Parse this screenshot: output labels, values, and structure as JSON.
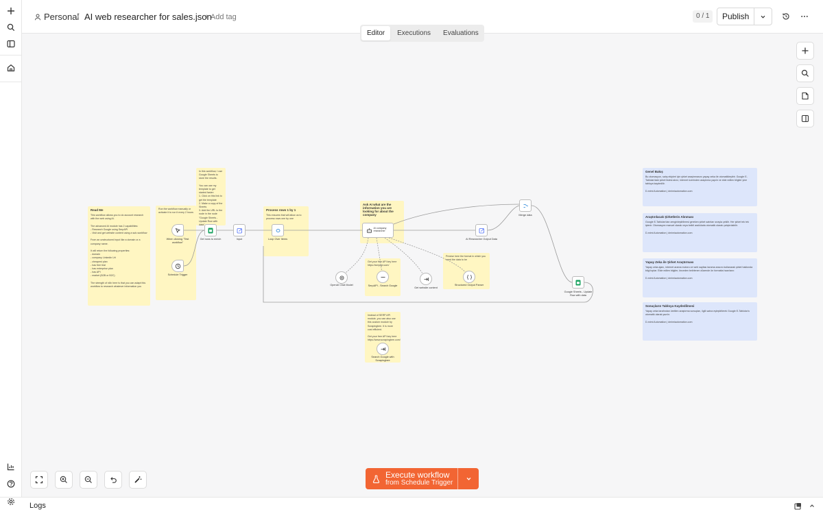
{
  "header": {
    "workspace": "Personal",
    "workflow_name": "AI web researcher for sales.json",
    "add_tag": "+ Add tag",
    "version_counter": "0 / 1",
    "publish_label": "Publish"
  },
  "tabs": [
    {
      "label": "Editor",
      "active": true
    },
    {
      "label": "Executions",
      "active": false
    },
    {
      "label": "Evaluations",
      "active": false
    }
  ],
  "execute": {
    "label": "Execute workflow",
    "sublabel": "from Schedule Trigger",
    "color": "#f26533"
  },
  "logs": {
    "label": "Logs"
  },
  "canvas": {
    "nodes": [
      {
        "label": "When clicking \"Test workflow\"",
        "icon": "cursor-icon"
      },
      {
        "label": "Schedule Trigger",
        "icon": "clock-icon"
      },
      {
        "label": "Get rows to enrich",
        "icon": "sheets-icon"
      },
      {
        "label": "Input",
        "icon": "edit-icon"
      },
      {
        "label": "Loop Over Items",
        "icon": "loop-icon"
      },
      {
        "label": "AI company researcher",
        "icon": "robot-icon"
      },
      {
        "label": "AI Researcher Output Data",
        "icon": "edit-icon"
      },
      {
        "label": "Merge data",
        "icon": "merge-icon"
      },
      {
        "label": "Google Sheets - Update Row with data",
        "icon": "sheets-icon"
      },
      {
        "label": "OpenAI Chat Model",
        "icon": "openai-icon"
      },
      {
        "label": "SerpAPI - Search Google",
        "icon": "serp-icon"
      },
      {
        "label": "Get website content",
        "icon": "arrow-icon"
      },
      {
        "label": "Structured Output Parser",
        "icon": "braces-icon"
      },
      {
        "label": "Search Google with Scrapingbee",
        "icon": "arrow-icon"
      }
    ],
    "stickies": [
      {
        "title": "Read Me",
        "text": "This workflow allows you to do account research with the web using AI.\n\nThe advanced AI module has 2 capabilities:\n- Research Google using SerpAPI\n- Visit and get website content using a sub-workflow\n\nFrom an unstructured input like a domain or a company name.\n\nIt will return the following properties:\n- domain\n- company Linkedin Url\n- cheapest plan\n- has free trial\n- has enterprise plan\n- has API\n- market (B2B or B2C)\n\nThe strength of n8n here is that you can adapt this workflow to research whatever information you"
      },
      {
        "title": "",
        "text": "Run the workflow manually or activate it to run it every 2 hours"
      },
      {
        "title": "",
        "text": "In this workflow, I use Google Sheets to store the results.\n\nYou can use my template to get started faster:\n1. Click on this link to get the template\n2. Make a copy of the Sheets\n3. Add the URL to the node in the node \"Google Sheets - Update Row with data\""
      },
      {
        "title": "Process rows 1 by 1",
        "text": "This ensures that will allow us to process rows one by one"
      },
      {
        "title": "Ask AI what are the information you are looking for about the company",
        "text": ""
      },
      {
        "title": "",
        "text": "Get your free API key here https://serpapi.com/"
      },
      {
        "title": "",
        "text": "Precise here the format in which you need the data to be"
      },
      {
        "title": "",
        "text": "Instead of SERP API module, you can also use this custom module by Scrapingbee. It is more cost efficient.\n\nGet your free API key here https://www.scrapingbee.com/"
      },
      {
        "title": "Genel Bakış",
        "text": "Bu otomasyon, satış ekipleri için şirket araştırmasını yapay zeka ile otomatikleştirir. Google E-Tablolar'daki şirket listesi alınır, internet üzerinden araştırma yapılır ve elde edilen bilgiler yine tabloya kaydedilir.\n\nD-mimi Automation | dmimiautomation.com"
      },
      {
        "title": "Araştırılacak Şirketlerin Alınması",
        "text": "Google E-Tablolar'dan zenginleştirilmesi gereken şirket satırları sırayla çekilir. Her şirket tek tek işlenir. Otomasyon manuel olarak veya belirli aralıklarla otomatik olarak çalıştırılabilir.\n\nD-mimi Automation | dmimiautomation.com"
      },
      {
        "title": "Yapay Zeka ile Şirket Araştırması",
        "text": "Yapay zeka ajanı, internet arama motoru ve web sayfası tarama aracını kullanarak şirket hakkında bilgi toplar. Elde edilen bilgiler, önceden belirlenen düzende ön formatta hazırlanır.\n\nD-mimi Automation | dmimiautomation.com"
      },
      {
        "title": "Sonuçların Tabloya Kaydedilmesi",
        "text": "Yapay zeka tarafından üretilen araştırma sonuçları, ilgili satıra eşleştirilerek Google E-Tablolar'a otomatik olarak yazılır.\n\nD-mimi Automation | dmimiautomation.com"
      }
    ]
  }
}
